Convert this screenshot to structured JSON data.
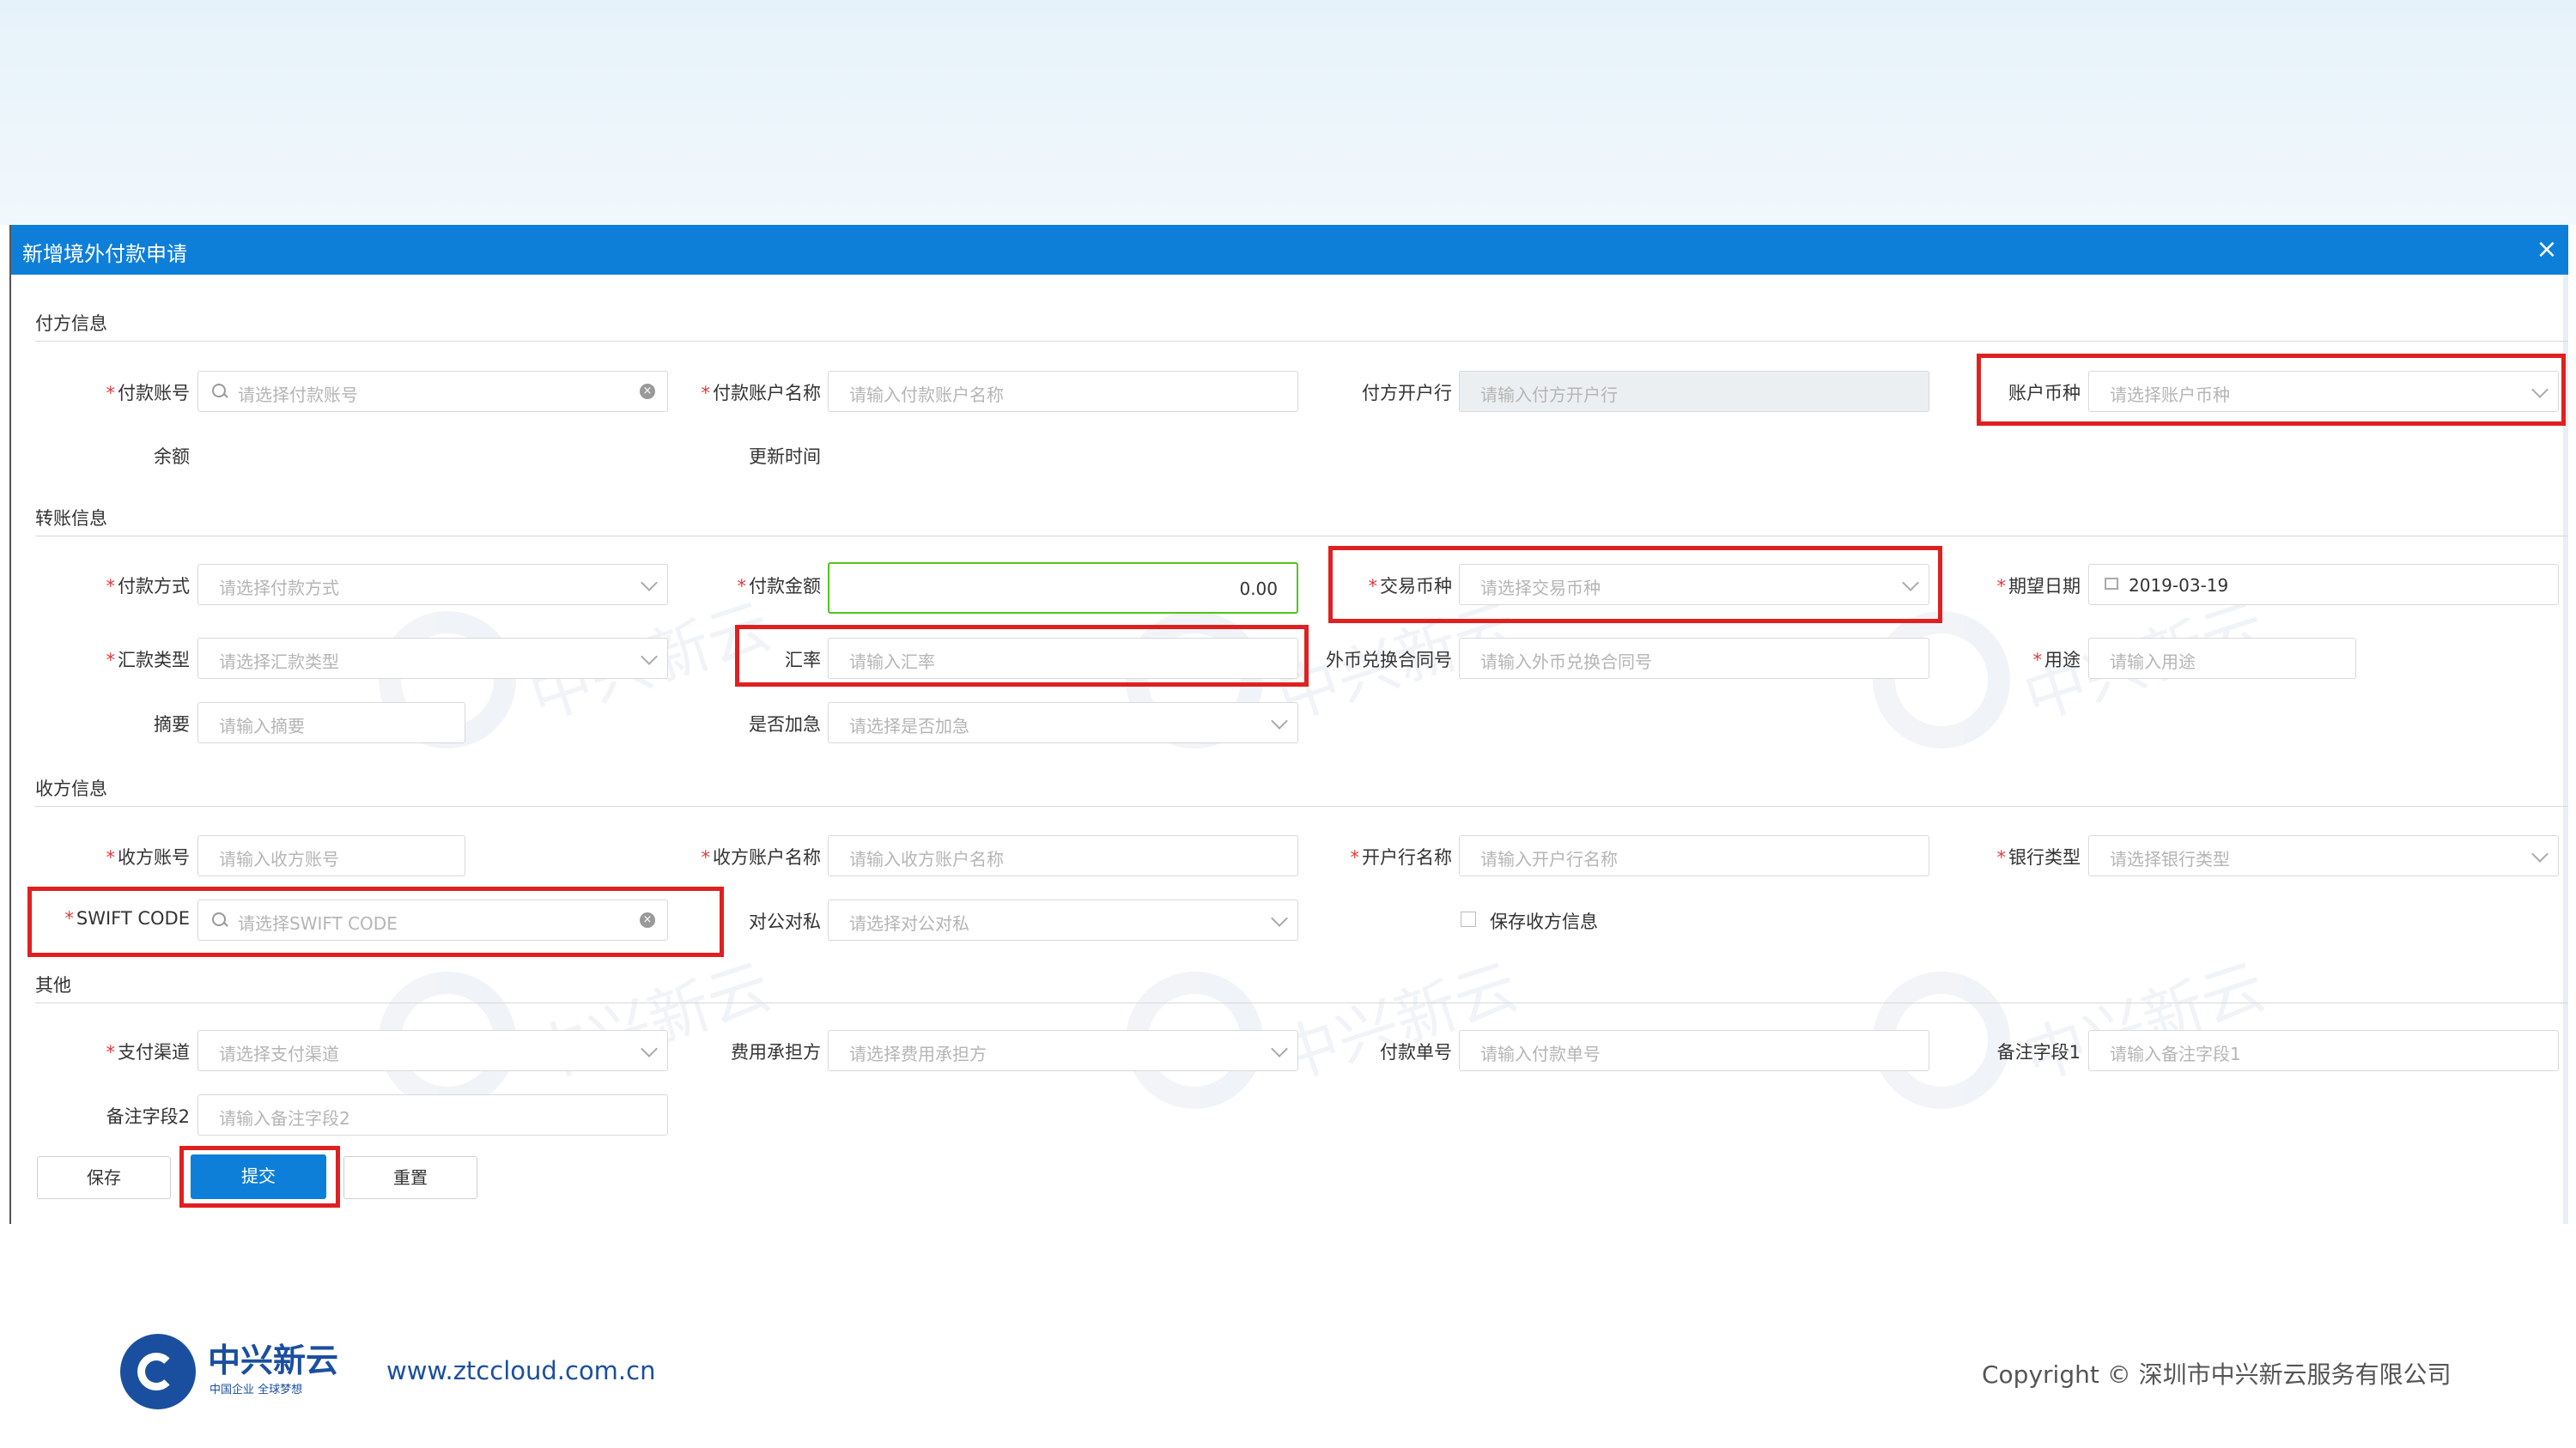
{
  "dialog": {
    "title": "新增境外付款申请",
    "close_icon": "×"
  },
  "sections": {
    "payer": "付方信息",
    "transfer": "转账信息",
    "payee": "收方信息",
    "other": "其他"
  },
  "payer": {
    "account_label": "付款账号",
    "account_placeholder": "请选择付款账号",
    "account_name_label": "付款账户名称",
    "account_name_placeholder": "请输入付款账户名称",
    "bank_label": "付方开户行",
    "bank_placeholder": "请输入付方开户行",
    "currency_label": "账户币种",
    "currency_placeholder": "请选择账户币种",
    "balance_label": "余额",
    "update_time_label": "更新时间"
  },
  "transfer": {
    "method_label": "付款方式",
    "method_placeholder": "请选择付款方式",
    "amount_label": "付款金额",
    "amount_value": "0.00",
    "trade_currency_label": "交易币种",
    "trade_currency_placeholder": "请选择交易币种",
    "expected_date_label": "期望日期",
    "expected_date_value": "2019-03-19",
    "remit_type_label": "汇款类型",
    "remit_type_placeholder": "请选择汇款类型",
    "rate_label": "汇率",
    "rate_placeholder": "请输入汇率",
    "fx_contract_label": "外币兑换合同号",
    "fx_contract_placeholder": "请输入外币兑换合同号",
    "purpose_label": "用途",
    "purpose_placeholder": "请输入用途",
    "summary_label": "摘要",
    "summary_placeholder": "请输入摘要",
    "urgent_label": "是否加急",
    "urgent_placeholder": "请选择是否加急"
  },
  "payee": {
    "account_label": "收方账号",
    "account_placeholder": "请输入收方账号",
    "account_name_label": "收方账户名称",
    "account_name_placeholder": "请输入收方账户名称",
    "bank_name_label": "开户行名称",
    "bank_name_placeholder": "请输入开户行名称",
    "bank_type_label": "银行类型",
    "bank_type_placeholder": "请选择银行类型",
    "swift_label": "SWIFT CODE",
    "swift_placeholder": "请选择SWIFT CODE",
    "public_private_label": "对公对私",
    "public_private_placeholder": "请选择对公对私",
    "save_info_label": "保存收方信息"
  },
  "other": {
    "channel_label": "支付渠道",
    "channel_placeholder": "请选择支付渠道",
    "fee_label": "费用承担方",
    "fee_placeholder": "请选择费用承担方",
    "order_no_label": "付款单号",
    "order_no_placeholder": "请输入付款单号",
    "remark1_label": "备注字段1",
    "remark1_placeholder": "请输入备注字段1",
    "remark2_label": "备注字段2",
    "remark2_placeholder": "请输入备注字段2"
  },
  "buttons": {
    "save": "保存",
    "submit": "提交",
    "reset": "重置"
  },
  "watermark_text": "中兴新云",
  "footer": {
    "logo_name": "中兴新云",
    "logo_slogan": "中国企业 全球梦想",
    "url": "www.ztccloud.com.cn",
    "copyright": "Copyright © 深圳市中兴新云服务有限公司"
  },
  "colors": {
    "header_blue": "#0e7fd9",
    "highlight_red": "#e02020",
    "required_red": "#e03b3b",
    "amount_border_green": "#52c41a"
  }
}
